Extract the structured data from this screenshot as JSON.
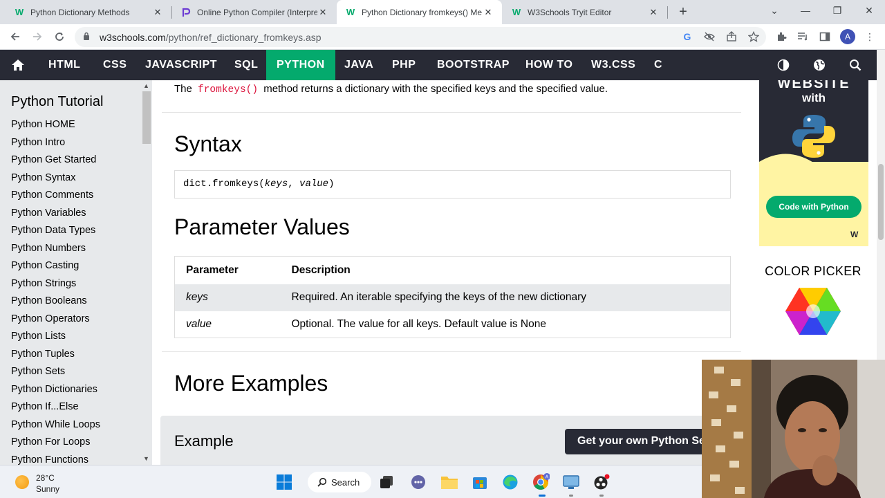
{
  "browser": {
    "tabs": [
      {
        "title": "Python Dictionary Methods",
        "favicon": "w3schools-icon",
        "active": false
      },
      {
        "title": "Online Python Compiler (Interpre",
        "favicon": "programiz-icon",
        "active": false
      },
      {
        "title": "Python Dictionary fromkeys() Me",
        "favicon": "w3schools-icon",
        "active": true
      },
      {
        "title": "W3Schools Tryit Editor",
        "favicon": "w3schools-icon",
        "active": false
      }
    ],
    "url_domain": "w3schools.com",
    "url_path": "/python/ref_dictionary_fromkeys.asp",
    "profile_initial": "A"
  },
  "topnav": {
    "items": [
      "HTML",
      "CSS",
      "JAVASCRIPT",
      "SQL",
      "PYTHON",
      "JAVA",
      "PHP",
      "BOOTSTRAP",
      "HOW TO",
      "W3.CSS",
      "C"
    ],
    "active": "PYTHON",
    "accent": "#04aa6d",
    "background": "#282a35"
  },
  "sidebar": {
    "title": "Python Tutorial",
    "links": [
      "Python HOME",
      "Python Intro",
      "Python Get Started",
      "Python Syntax",
      "Python Comments",
      "Python Variables",
      "Python Data Types",
      "Python Numbers",
      "Python Casting",
      "Python Strings",
      "Python Booleans",
      "Python Operators",
      "Python Lists",
      "Python Tuples",
      "Python Sets",
      "Python Dictionaries",
      "Python If...Else",
      "Python While Loops",
      "Python For Loops",
      "Python Functions"
    ]
  },
  "main": {
    "intro_before": "The",
    "intro_code": "fromkeys()",
    "intro_after": "method returns a dictionary with the specified keys and the specified value.",
    "syntax_heading": "Syntax",
    "syntax_prefix": "dict.fromkeys(",
    "syntax_arg1": "keys",
    "syntax_sep": ", ",
    "syntax_arg2": "value",
    "syntax_suffix": ")",
    "params_heading": "Parameter Values",
    "params_table": {
      "headers": [
        "Parameter",
        "Description"
      ],
      "rows": [
        [
          "keys",
          "Required. An iterable specifying the keys of the new dictionary"
        ],
        [
          "value",
          "Optional. The value for all keys. Default value is None"
        ]
      ]
    },
    "more_heading": "More Examples",
    "example_title": "Example",
    "get_server_button": "Get your own Python Ser"
  },
  "right_sidebar": {
    "ad_top_text": "WEBSITE",
    "ad_with": "with",
    "ad_button": "Code with Python",
    "ad_mark": "W",
    "color_picker_title": "COLOR PICKER"
  },
  "taskbar": {
    "temperature": "28°C",
    "weather": "Sunny",
    "search_label": "Search"
  }
}
